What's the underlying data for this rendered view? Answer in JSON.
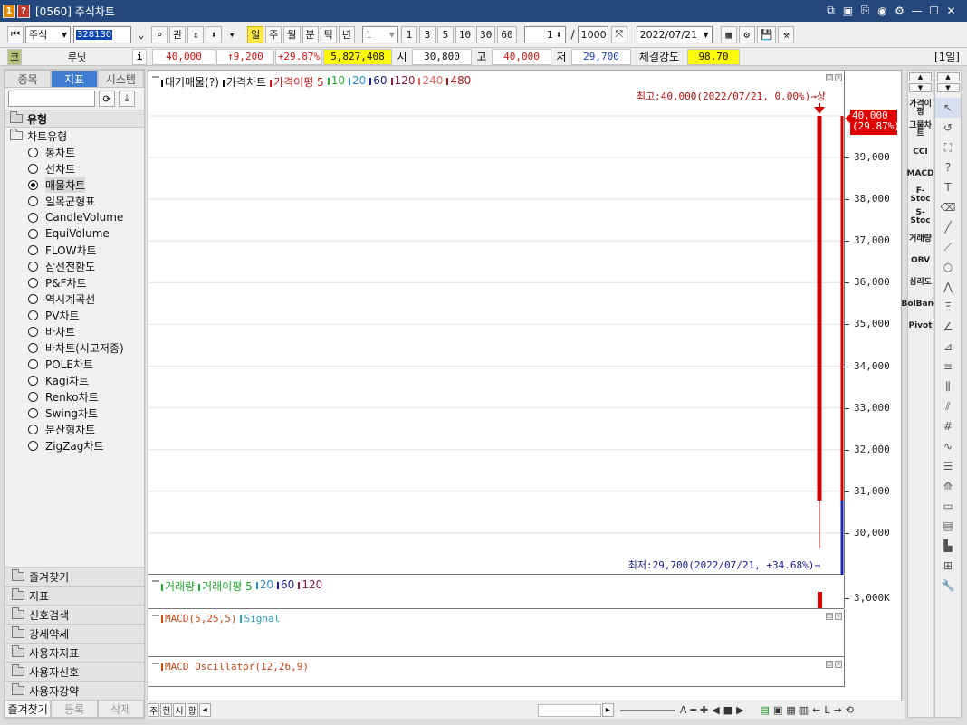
{
  "window": {
    "badge_num": "1",
    "badge_q": "?",
    "title": "[0560] 주식차트"
  },
  "toolbar": {
    "market": "주식",
    "code": "328130",
    "btn_gwan": "관",
    "periods": [
      "일",
      "주",
      "월",
      "분",
      "틱",
      "년"
    ],
    "active_period": "일",
    "interval": "1",
    "quick_intervals": [
      "1",
      "3",
      "5",
      "10",
      "30",
      "60"
    ],
    "count": "1",
    "separator": "/",
    "total": "1000",
    "date": "2022/07/21"
  },
  "quote": {
    "code_tag": "코",
    "name": "루닛",
    "info_btn": "i",
    "price": "40,000",
    "change": "↑9,200",
    "change_pct": "+29.87%",
    "volume": "5,827,408",
    "open_label": "시",
    "open": "30,800",
    "high_label": "고",
    "high": "40,000",
    "low_label": "저",
    "low": "29,700",
    "strength_label": "체결강도",
    "strength": "98.70",
    "period_tag": "[1일]"
  },
  "left_panel": {
    "tabs": [
      "종목",
      "지표",
      "시스템"
    ],
    "active_tab": "지표",
    "section_title": "유형",
    "root_label": "차트유형",
    "chart_types": [
      "봉차트",
      "선차트",
      "매물차트",
      "일목균형표",
      "CandleVolume",
      "EquiVolume",
      "FLOW차트",
      "삼선전환도",
      "P&F차트",
      "역시계곡선",
      "PV차트",
      "바차트",
      "바차트(시고저종)",
      "POLE차트",
      "Kagi차트",
      "Renko차트",
      "Swing차트",
      "분산형차트",
      "ZigZag차트"
    ],
    "selected_type": "매물차트",
    "bottom_sections": [
      "즐겨찾기",
      "지표",
      "신호검색",
      "강세약세",
      "사용자지표",
      "사용자신호",
      "사용자강약"
    ],
    "bottom_tabs": [
      "즐겨찾기",
      "등록",
      "삭제"
    ]
  },
  "main_pane": {
    "legend": [
      {
        "text": "대기매물(?)",
        "color": "#111111"
      },
      {
        "text": "가격차트",
        "color": "#111111"
      },
      {
        "text": "가격이평 5",
        "color": "#c41a1a"
      },
      {
        "text": "10",
        "color": "#27a834"
      },
      {
        "text": "20",
        "color": "#2a8fd1"
      },
      {
        "text": "60",
        "color": "#1a1a8a"
      },
      {
        "text": "120",
        "color": "#8a1a3a"
      },
      {
        "text": "240",
        "color": "#e06a6a"
      },
      {
        "text": "480",
        "color": "#a01a1a"
      }
    ],
    "high_annotation": "최고:40,000(2022/07/21, 0.00%)→상",
    "low_annotation": "최저:29,700(2022/07/21, +34.68%)→",
    "price_tag": "40,000",
    "price_tag_pct": "(29.87%)",
    "y_ticks": [
      "39,000",
      "38,000",
      "37,000",
      "36,000",
      "35,000",
      "34,000",
      "33,000",
      "32,000",
      "31,000",
      "30,000"
    ]
  },
  "volume_pane": {
    "legend": [
      {
        "text": "거래량",
        "color": "#27a834"
      },
      {
        "text": "거래이평 5",
        "color": "#27a834"
      },
      {
        "text": "20",
        "color": "#2a8fd1"
      },
      {
        "text": "60",
        "color": "#1a1a8a"
      },
      {
        "text": "120",
        "color": "#8a1a3a"
      }
    ],
    "y_tick": "3,000K"
  },
  "macd_pane": {
    "legend": [
      {
        "text": "MACD(5,25,5)",
        "color": "#c44a1a"
      },
      {
        "text": "Signal",
        "color": "#2aa8b8"
      }
    ]
  },
  "osc_pane": {
    "legend": [
      {
        "text": "MACD Oscillator(12,26,9)",
        "color": "#c44a1a"
      }
    ]
  },
  "indicators": [
    {
      "label": "가격이평"
    },
    {
      "label": "그물차트"
    },
    {
      "label": "CCI"
    },
    {
      "label": "MACD"
    },
    {
      "label": "F-Stoc"
    },
    {
      "label": "S-Stoc"
    },
    {
      "label": "거래량"
    },
    {
      "label": "OBV"
    },
    {
      "label": "심리도"
    },
    {
      "label": "BolBand"
    },
    {
      "label": "Pivot"
    }
  ],
  "bottom_bar": {
    "tabs": [
      "주",
      "현",
      "시",
      "황"
    ]
  }
}
